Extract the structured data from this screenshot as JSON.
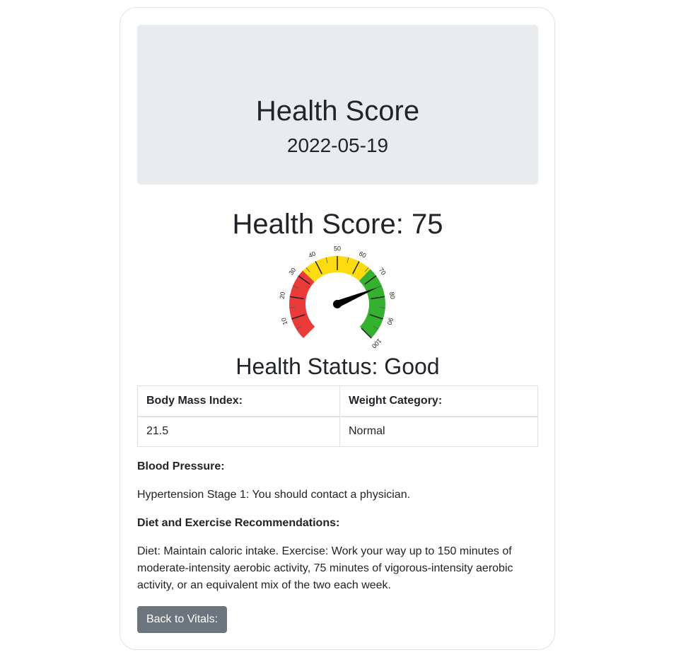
{
  "header": {
    "title": "Health Score",
    "date": "2022-05-19"
  },
  "score": {
    "heading": "Health Score: 75",
    "value": 75
  },
  "gauge": {
    "min": 0,
    "max": 100,
    "tick_labels": [
      "10",
      "20",
      "30",
      "40",
      "50",
      "60",
      "70",
      "80",
      "90",
      "100"
    ],
    "zones": [
      {
        "from": 0,
        "to": 33,
        "color": "#ea3a3a"
      },
      {
        "from": 33,
        "to": 66,
        "color": "#fcdb11"
      },
      {
        "from": 66,
        "to": 100,
        "color": "#36b12f"
      }
    ]
  },
  "status": {
    "heading": "Health Status: Good"
  },
  "vitals_table": {
    "headers": [
      "Body Mass Index:",
      "Weight Category:"
    ],
    "rows": [
      [
        "21.5",
        "Normal"
      ]
    ]
  },
  "blood_pressure": {
    "label": "Blood Pressure:",
    "text": "Hypertension Stage 1: You should contact a physician."
  },
  "recommendations": {
    "label": "Diet and Exercise Recommendations:",
    "text": "Diet: Maintain caloric intake. Exercise: Work your way up to 150 minutes of moderate-intensity aerobic activity, 75 minutes of vigorous-intensity aerobic activity, or an equivalent mix of the two each week."
  },
  "actions": {
    "back_label": "Back to Vitals:"
  }
}
